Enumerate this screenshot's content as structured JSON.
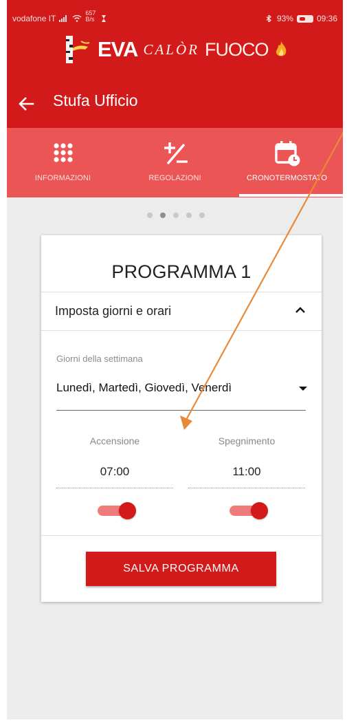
{
  "status_bar": {
    "carrier": "vodafone IT",
    "net_speed_value": "657",
    "net_speed_unit": "B/s",
    "battery": "93%",
    "time": "09:36"
  },
  "brand": {
    "name_1": "EVA",
    "name_2": "CALÒR",
    "name_3": "FUOCO"
  },
  "header": {
    "title": "Stufa Ufficio"
  },
  "tabs": [
    {
      "label": "INFORMAZIONI",
      "icon": "grid-icon",
      "active": false
    },
    {
      "label": "REGOLAZIONI",
      "icon": "plus-minus-icon",
      "active": false
    },
    {
      "label": "CRONOTERMOSTATO",
      "icon": "calendar-clock-icon",
      "active": true
    }
  ],
  "pager": {
    "count": 5,
    "current": 2
  },
  "program": {
    "title": "PROGRAMMA 1",
    "section_title": "Imposta giorni e orari",
    "days_label": "Giorni della settimana",
    "days_value": "Lunedì, Martedì, Giovedì, Venerdì",
    "on_label": "Accensione",
    "on_time": "07:00",
    "on_enabled": true,
    "off_label": "Spegnimento",
    "off_time": "11:00",
    "off_enabled": true,
    "save_label": "SALVA PROGRAMMA"
  },
  "colors": {
    "primary": "#d21a1a",
    "tab_bar": "#ec5555",
    "annotation_arrow": "#e8893a"
  }
}
